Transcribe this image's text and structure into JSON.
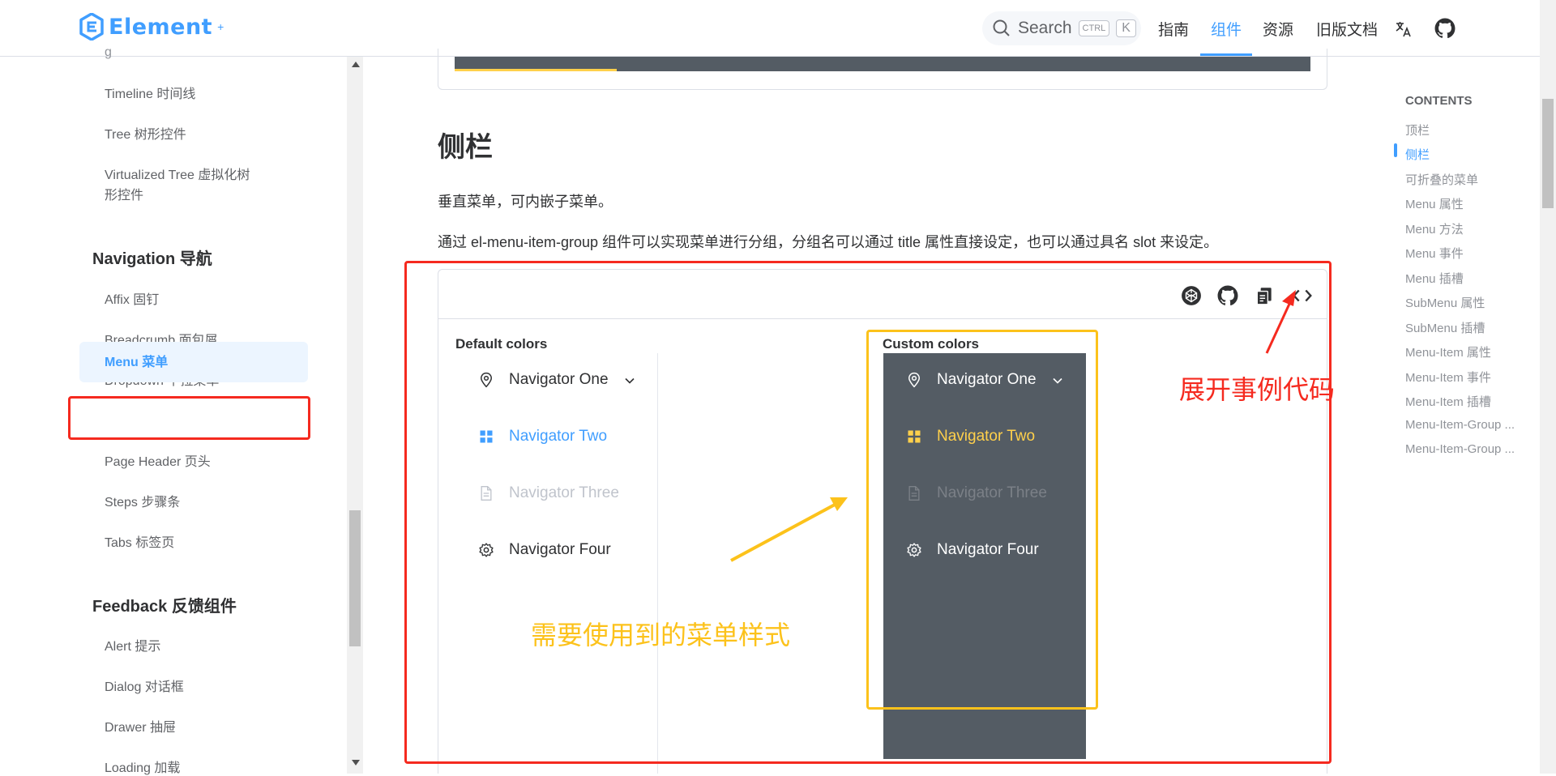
{
  "header": {
    "logo_text": "Element",
    "logo_sup": "+",
    "search_placeholder": "Search",
    "search_key1": "CTRL",
    "search_key2": "K",
    "nav": [
      "指南",
      "组件",
      "资源",
      "旧版文档"
    ],
    "active_nav": "组件",
    "icons": [
      "translate-icon",
      "github-icon"
    ]
  },
  "sidebar": {
    "items_top": [
      "Timeline 时间线",
      "Tree 树形控件",
      "Virtualized Tree 虚拟化树",
      "形控件"
    ],
    "group_nav": "Navigation 导航",
    "nav_items": [
      "Affix 固钉",
      "Breadcrumb 面包屑",
      "Dropdown 下拉菜单",
      "Menu 菜单",
      "Page Header 页头",
      "Steps 步骤条",
      "Tabs 标签页"
    ],
    "group_feedback": "Feedback 反馈组件",
    "feedback_items": [
      "Alert 提示",
      "Dialog 对话框",
      "Drawer 抽屉",
      "Loading 加载"
    ]
  },
  "content": {
    "section_title": "侧栏",
    "para1": "垂直菜单，可内嵌子菜单。",
    "para2": "通过 el-menu-item-group 组件可以实现菜单进行分组，分组名可以通过 title 属性直接设定，也可以通过具名 slot 来设定。",
    "demo": {
      "default_label": "Default colors",
      "custom_label": "Custom colors",
      "menu_items": [
        "Navigator One",
        "Navigator Two",
        "Navigator Three",
        "Navigator Four"
      ],
      "op_icons": [
        "codepen-icon",
        "github-icon",
        "copy-icon",
        "code-icon"
      ]
    }
  },
  "annotations": {
    "expand_code": "展开事例代码",
    "menu_style": "需要使用到的菜单样式"
  },
  "toc": {
    "title": "CONTENTS",
    "items": [
      "顶栏",
      "侧栏",
      "可折叠的菜单",
      "Menu 属性",
      "Menu 方法",
      "Menu 事件",
      "Menu 插槽",
      "SubMenu 属性",
      "SubMenu 插槽",
      "Menu-Item 属性",
      "Menu-Item 事件",
      "Menu-Item 插槽",
      "Menu-Item-Group ...",
      "Menu-Item-Group ..."
    ],
    "active": "侧栏"
  },
  "colors": {
    "brand": "#409eff",
    "dark_menu_bg": "#545c64",
    "dark_menu_active": "#ffd04b",
    "annotation_red": "#f52a1f",
    "annotation_yellow": "#fcc21b"
  }
}
